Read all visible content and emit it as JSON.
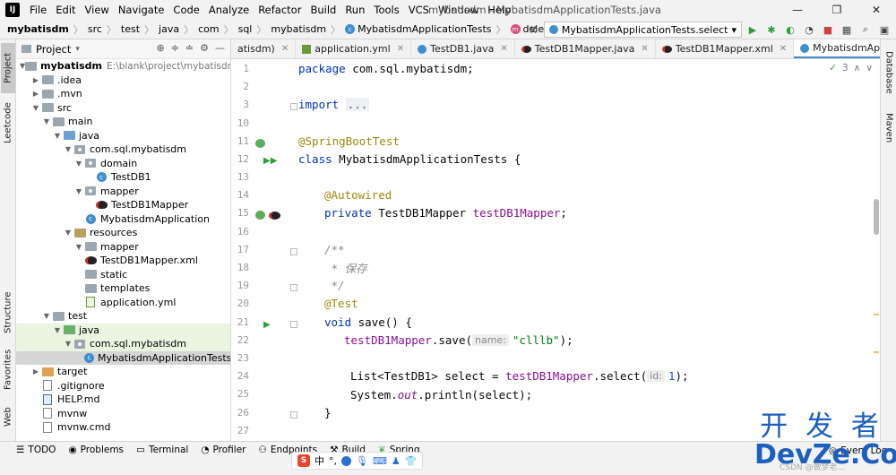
{
  "menubar": {
    "logo": "IJ",
    "items": [
      "File",
      "Edit",
      "View",
      "Navigate",
      "Code",
      "Analyze",
      "Refactor",
      "Build",
      "Run",
      "Tools",
      "VCS",
      "Window",
      "Help"
    ],
    "window_title": "mybatisdm - MybatisdmApplicationTests.java"
  },
  "breadcrumb": {
    "items": [
      "mybatisdm",
      "src",
      "test",
      "java",
      "com",
      "sql",
      "mybatisdm",
      "MybatisdmApplicationTests",
      "delete"
    ]
  },
  "toolbar": {
    "run_config": "MybatisdmApplicationTests.select"
  },
  "left_tabs": [
    "Project",
    "Leetcode",
    "Structure",
    "Favorites",
    "Web"
  ],
  "project_panel": {
    "title": "Project",
    "tree": [
      {
        "label": "mybatisdm",
        "path": "E:\\blank\\project\\mybatisdm",
        "bold": true
      },
      {
        "label": ".idea"
      },
      {
        "label": ".mvn"
      },
      {
        "label": "src"
      },
      {
        "label": "main"
      },
      {
        "label": "java"
      },
      {
        "label": "com.sql.mybatisdm"
      },
      {
        "label": "domain"
      },
      {
        "label": "TestDB1"
      },
      {
        "label": "mapper"
      },
      {
        "label": "TestDB1Mapper"
      },
      {
        "label": "MybatisdmApplication"
      },
      {
        "label": "resources"
      },
      {
        "label": "mapper"
      },
      {
        "label": "TestDB1Mapper.xml"
      },
      {
        "label": "static"
      },
      {
        "label": "templates"
      },
      {
        "label": "application.yml"
      },
      {
        "label": "test"
      },
      {
        "label": "java"
      },
      {
        "label": "com.sql.mybatisdm"
      },
      {
        "label": "MybatisdmApplicationTests"
      },
      {
        "label": "target"
      },
      {
        "label": ".gitignore"
      },
      {
        "label": "HELP.md"
      },
      {
        "label": "mvnw"
      },
      {
        "label": "mvnw.cmd"
      }
    ]
  },
  "editor": {
    "tabs": [
      "atisdm)",
      "application.yml",
      "TestDB1.java",
      "TestDB1Mapper.java",
      "TestDB1Mapper.xml",
      "MybatisdmApplicationTests.java"
    ],
    "inspection_count": "3",
    "line_numbers": [
      "1",
      "2",
      "3",
      "10",
      "11",
      "12",
      "13",
      "14",
      "15",
      "16",
      "17",
      "18",
      "19",
      "20",
      "21",
      "22",
      "23",
      "24",
      "25",
      "26",
      "27"
    ],
    "code": {
      "l1_kw": "package",
      "l1_rest": " com.sql.mybatisdm;",
      "l3_kw": "import",
      "l3_dots": "...",
      "l11_ann": "@SpringBootTest",
      "l12_kw": "class",
      "l12_rest": " MybatisdmApplicationTests {",
      "l14_ann": "@Autowired",
      "l15_kw": "private",
      "l15_type": " TestDB1Mapper ",
      "l15_fld": "testDB1Mapper",
      "l15_end": ";",
      "l17": "/**",
      "l18": " * 保存",
      "l19": " */",
      "l20_ann": "@Test",
      "l21_kw": "void",
      "l21_rest": " save() {",
      "l22_fld": "testDB1Mapper",
      "l22_call": ".save(",
      "l22_hint": "name:",
      "l22_str": "\"clllb\"",
      "l22_end": ");",
      "l24_a": "List<TestDB1> select = ",
      "l24_fld": "testDB1Mapper",
      "l24_call": ".select(",
      "l24_hint": "id:",
      "l24_num": "1",
      "l24_end": ");",
      "l25_a": "System.",
      "l25_out": "out",
      "l25_b": ".println(select);",
      "l26": "}"
    }
  },
  "right_tabs": [
    "Database",
    "Maven"
  ],
  "bottom": {
    "tools": [
      "TODO",
      "Problems",
      "Terminal",
      "Profiler",
      "Endpoints",
      "Build",
      "Spring"
    ],
    "event_log": "Event Log",
    "ime_label": "中"
  },
  "watermark": {
    "top": "开 发 者",
    "bottom": "DevZe.CoM",
    "small": "CSDN @做梦老..."
  }
}
